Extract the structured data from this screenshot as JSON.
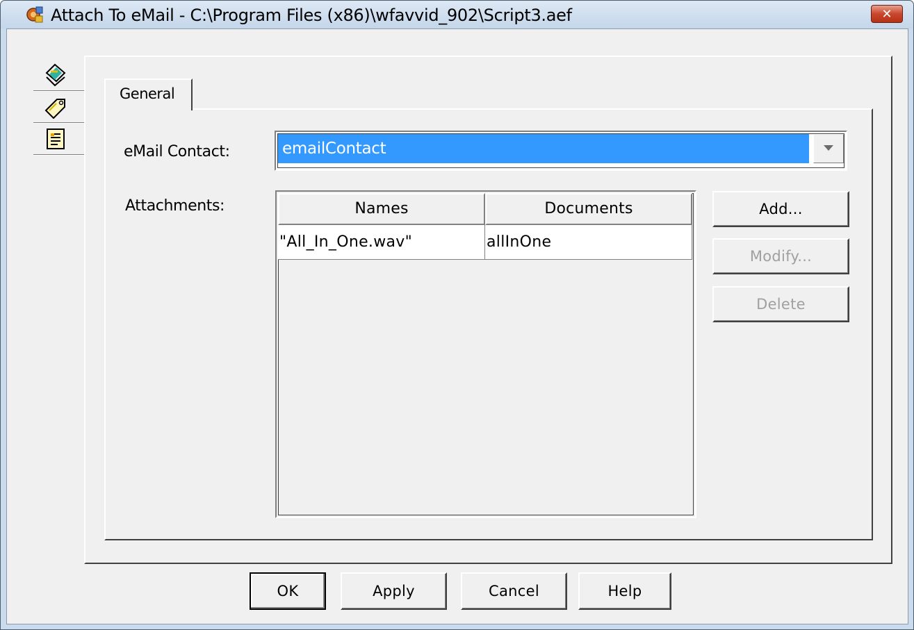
{
  "window": {
    "title": "Attach To eMail - C:\\Program Files (x86)\\wfavvid_902\\Script3.aef",
    "close_label": "✕",
    "icon": "app-script-icon"
  },
  "side_tabs": [
    {
      "icon": "general-tag-icon",
      "selected": true
    },
    {
      "icon": "label-tag-icon",
      "selected": false
    },
    {
      "icon": "notes-document-icon",
      "selected": false
    }
  ],
  "tab": {
    "label": "General"
  },
  "form": {
    "contact_label": "eMail Contact:",
    "contact_value": "emailContact",
    "attachments_label": "Attachments:"
  },
  "table": {
    "columns": [
      "Names",
      "Documents"
    ],
    "rows": [
      {
        "name": "\"All_In_One.wav\"",
        "document": "allInOne"
      }
    ]
  },
  "side_buttons": {
    "add": "Add...",
    "modify": "Modify...",
    "delete": "Delete"
  },
  "footer_buttons": {
    "ok": "OK",
    "apply": "Apply",
    "cancel": "Cancel",
    "help": "Help"
  },
  "colors": {
    "selection": "#3399ff",
    "dialog_bg": "#f0f0f0",
    "frame": "#c9dbed",
    "close": "#c9462c"
  }
}
